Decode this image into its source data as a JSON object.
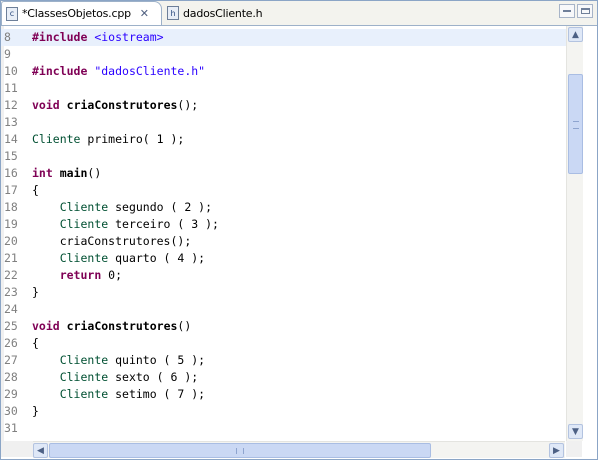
{
  "tabs": [
    {
      "label": "*ClassesObjetos.cpp",
      "icon": "cpp-file-icon",
      "icon_glyph": "c",
      "active": true
    },
    {
      "label": "dadosCliente.h",
      "icon": "header-file-icon",
      "icon_glyph": "h",
      "active": false
    }
  ],
  "colors": {
    "keyword": "#7f0055",
    "string": "#2a00ff",
    "type": "#005032",
    "current_line": "#e8f0fc",
    "line_number": "#808080"
  },
  "editor": {
    "current_line": 8,
    "lines": [
      {
        "n": "8",
        "segments": [
          {
            "t": "#include",
            "c": "kw"
          },
          {
            "t": " ",
            "c": ""
          },
          {
            "t": "<iostream>",
            "c": "str"
          }
        ]
      },
      {
        "n": "9",
        "segments": []
      },
      {
        "n": "10",
        "segments": [
          {
            "t": "#include",
            "c": "kw"
          },
          {
            "t": " ",
            "c": ""
          },
          {
            "t": "\"dadosCliente.h\"",
            "c": "str"
          }
        ]
      },
      {
        "n": "11",
        "segments": []
      },
      {
        "n": "12",
        "segments": [
          {
            "t": "void",
            "c": "kw"
          },
          {
            "t": " ",
            "c": ""
          },
          {
            "t": "criaConstrutores",
            "c": "fn"
          },
          {
            "t": "();",
            "c": ""
          }
        ]
      },
      {
        "n": "13",
        "segments": []
      },
      {
        "n": "14",
        "segments": [
          {
            "t": "Cliente",
            "c": "type"
          },
          {
            "t": " primeiro( 1 );",
            "c": ""
          }
        ]
      },
      {
        "n": "15",
        "segments": []
      },
      {
        "n": "16",
        "segments": [
          {
            "t": "int",
            "c": "kw"
          },
          {
            "t": " ",
            "c": ""
          },
          {
            "t": "main",
            "c": "fn"
          },
          {
            "t": "()",
            "c": ""
          }
        ]
      },
      {
        "n": "17",
        "segments": [
          {
            "t": "{",
            "c": ""
          }
        ]
      },
      {
        "n": "18",
        "segments": [
          {
            "t": "    ",
            "c": ""
          },
          {
            "t": "Cliente",
            "c": "type"
          },
          {
            "t": " segundo ( 2 );",
            "c": ""
          }
        ]
      },
      {
        "n": "19",
        "segments": [
          {
            "t": "    ",
            "c": ""
          },
          {
            "t": "Cliente",
            "c": "type"
          },
          {
            "t": " terceiro ( 3 );",
            "c": ""
          }
        ]
      },
      {
        "n": "20",
        "segments": [
          {
            "t": "    criaConstrutores();",
            "c": ""
          }
        ]
      },
      {
        "n": "21",
        "segments": [
          {
            "t": "    ",
            "c": ""
          },
          {
            "t": "Cliente",
            "c": "type"
          },
          {
            "t": " quarto ( 4 );",
            "c": ""
          }
        ]
      },
      {
        "n": "22",
        "segments": [
          {
            "t": "    ",
            "c": ""
          },
          {
            "t": "return",
            "c": "kw"
          },
          {
            "t": " 0;",
            "c": ""
          }
        ]
      },
      {
        "n": "23",
        "segments": [
          {
            "t": "}",
            "c": ""
          }
        ]
      },
      {
        "n": "24",
        "segments": []
      },
      {
        "n": "25",
        "segments": [
          {
            "t": "void",
            "c": "kw"
          },
          {
            "t": " ",
            "c": ""
          },
          {
            "t": "criaConstrutores",
            "c": "fn"
          },
          {
            "t": "()",
            "c": ""
          }
        ]
      },
      {
        "n": "26",
        "segments": [
          {
            "t": "{",
            "c": ""
          }
        ]
      },
      {
        "n": "27",
        "segments": [
          {
            "t": "    ",
            "c": ""
          },
          {
            "t": "Cliente",
            "c": "type"
          },
          {
            "t": " quinto ( 5 );",
            "c": ""
          }
        ]
      },
      {
        "n": "28",
        "segments": [
          {
            "t": "    ",
            "c": ""
          },
          {
            "t": "Cliente",
            "c": "type"
          },
          {
            "t": " sexto ( 6 );",
            "c": ""
          }
        ]
      },
      {
        "n": "29",
        "segments": [
          {
            "t": "    ",
            "c": ""
          },
          {
            "t": "Cliente",
            "c": "type"
          },
          {
            "t": " setimo ( 7 );",
            "c": ""
          }
        ]
      },
      {
        "n": "30",
        "segments": [
          {
            "t": "}",
            "c": ""
          }
        ]
      },
      {
        "n": "31",
        "segments": []
      }
    ]
  }
}
